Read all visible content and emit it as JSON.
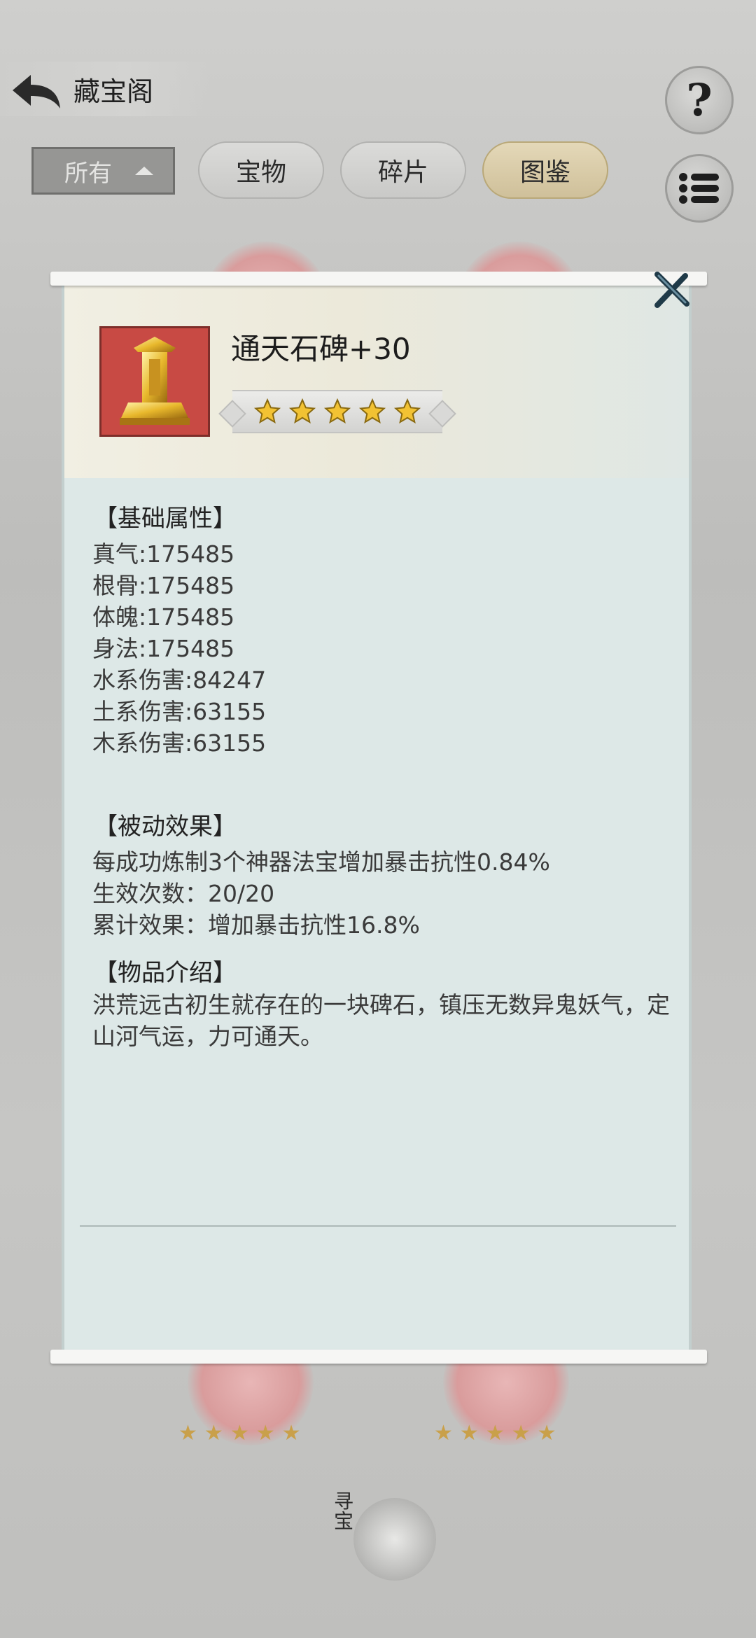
{
  "header": {
    "title": "藏宝阁"
  },
  "filters": {
    "dropdown_value": "所有",
    "tabs": [
      "宝物",
      "碎片",
      "图鉴"
    ]
  },
  "detail": {
    "item_name": "通天石碑+30",
    "stars": 5,
    "base_heading": "【基础属性】",
    "base_attributes": [
      "真气:175485",
      "根骨:175485",
      "体魄:175485",
      "身法:175485",
      "水系伤害:84247",
      "土系伤害:63155",
      "木系伤害:63155"
    ],
    "passive_heading": "【被动效果】",
    "passive_lines": [
      "每成功炼制3个神器法宝增加暴击抗性0.84%",
      "生效次数：20/20",
      "累计效果：增加暴击抗性16.8%"
    ],
    "intro_heading": "【物品介绍】",
    "intro_text": "洪荒远古初生就存在的一块碑石，镇压无数异鬼妖气，定山河气运，力可通天。"
  },
  "seek_button": {
    "label": "寻宝"
  },
  "colors": {
    "icon_bg": "#c84a44",
    "panel_bg": "#dde8e7",
    "star": "#f2c233"
  }
}
